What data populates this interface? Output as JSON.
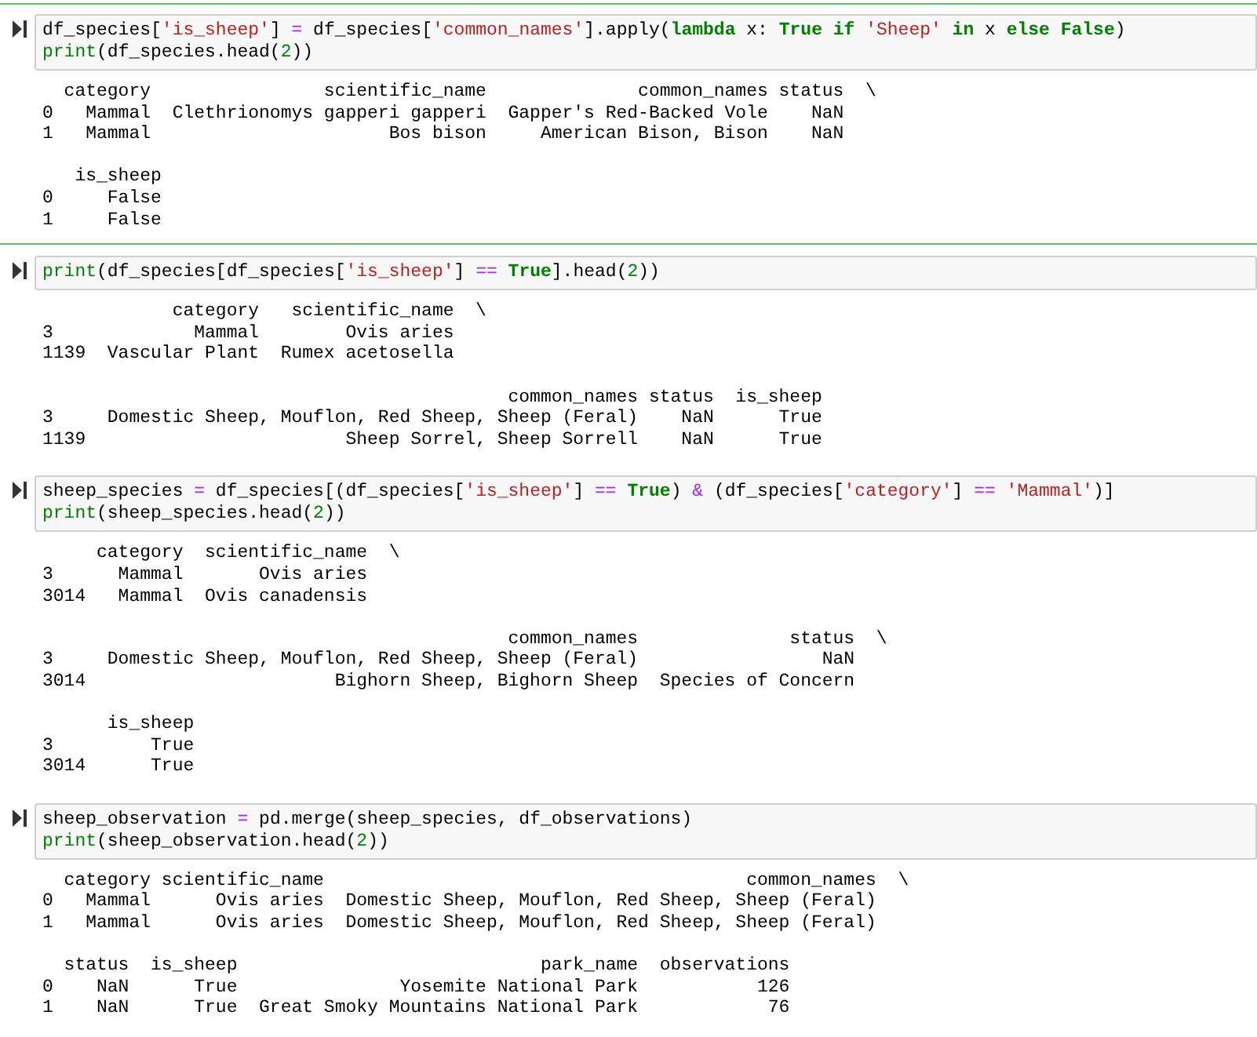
{
  "cells": [
    {
      "selected": true,
      "input": [
        {
          "tokens": [
            {
              "kind": "plain",
              "text": "df_species["
            },
            {
              "kind": "string",
              "text": "'is_sheep'"
            },
            {
              "kind": "plain",
              "text": "] "
            },
            {
              "kind": "operator",
              "text": "="
            },
            {
              "kind": "plain",
              "text": " df_species["
            },
            {
              "kind": "string",
              "text": "'common_names'"
            },
            {
              "kind": "plain",
              "text": "].apply("
            },
            {
              "kind": "keyword",
              "text": "lambda"
            },
            {
              "kind": "plain",
              "text": " x: "
            },
            {
              "kind": "keyword",
              "text": "True"
            },
            {
              "kind": "keyword",
              "text": " if"
            },
            {
              "kind": "string",
              "text": " 'Sheep'"
            },
            {
              "kind": "keyword",
              "text": " in"
            },
            {
              "kind": "plain",
              "text": " x "
            },
            {
              "kind": "keyword",
              "text": "else"
            },
            {
              "kind": "keyword",
              "text": " False"
            },
            {
              "kind": "plain",
              "text": ")"
            }
          ]
        },
        {
          "tokens": [
            {
              "kind": "builtin",
              "text": "print"
            },
            {
              "kind": "plain",
              "text": "(df_species.head("
            },
            {
              "kind": "number",
              "text": "2"
            },
            {
              "kind": "plain",
              "text": "))"
            }
          ]
        }
      ],
      "output": [
        {
          "lines": [
            "  category                scientific_name              common_names status  \\",
            "0   Mammal  Clethrionomys gapperi gapperi  Gapper's Red-Backed Vole    NaN",
            "1   Mammal                      Bos bison     American Bison, Bison    NaN"
          ]
        },
        {
          "lines": [
            "   is_sheep",
            "0     False",
            "1     False"
          ]
        }
      ]
    },
    {
      "selected": false,
      "input": [
        {
          "tokens": [
            {
              "kind": "builtin",
              "text": "print"
            },
            {
              "kind": "plain",
              "text": "(df_species[df_species["
            },
            {
              "kind": "string",
              "text": "'is_sheep'"
            },
            {
              "kind": "plain",
              "text": "] "
            },
            {
              "kind": "operator",
              "text": "=="
            },
            {
              "kind": "keyword",
              "text": " True"
            },
            {
              "kind": "plain",
              "text": "].head("
            },
            {
              "kind": "number",
              "text": "2"
            },
            {
              "kind": "plain",
              "text": "))"
            }
          ]
        }
      ],
      "output": [
        {
          "lines": [
            "            category   scientific_name  \\",
            "3             Mammal        Ovis aries",
            "1139  Vascular Plant  Rumex acetosella"
          ]
        },
        {
          "lines": [
            "                                           common_names status  is_sheep",
            "3     Domestic Sheep, Mouflon, Red Sheep, Sheep (Feral)    NaN      True",
            "1139                        Sheep Sorrel, Sheep Sorrell    NaN      True"
          ]
        }
      ]
    },
    {
      "selected": false,
      "input": [
        {
          "tokens": [
            {
              "kind": "plain",
              "text": "sheep_species "
            },
            {
              "kind": "operator",
              "text": "="
            },
            {
              "kind": "plain",
              "text": " df_species[(df_species["
            },
            {
              "kind": "string",
              "text": "'is_sheep'"
            },
            {
              "kind": "plain",
              "text": "] "
            },
            {
              "kind": "operator",
              "text": "=="
            },
            {
              "kind": "keyword",
              "text": " True"
            },
            {
              "kind": "plain",
              "text": ") "
            },
            {
              "kind": "operator",
              "text": "&"
            },
            {
              "kind": "plain",
              "text": " (df_species["
            },
            {
              "kind": "string",
              "text": "'category'"
            },
            {
              "kind": "plain",
              "text": "] "
            },
            {
              "kind": "operator",
              "text": "=="
            },
            {
              "kind": "string",
              "text": " 'Mammal'"
            },
            {
              "kind": "plain",
              "text": ")]"
            }
          ]
        },
        {
          "tokens": [
            {
              "kind": "builtin",
              "text": "print"
            },
            {
              "kind": "plain",
              "text": "(sheep_species.head("
            },
            {
              "kind": "number",
              "text": "2"
            },
            {
              "kind": "plain",
              "text": "))"
            }
          ]
        }
      ],
      "output": [
        {
          "lines": [
            "     category  scientific_name  \\",
            "3      Mammal       Ovis aries",
            "3014   Mammal  Ovis canadensis"
          ]
        },
        {
          "lines": [
            "                                           common_names              status  \\",
            "3     Domestic Sheep, Mouflon, Red Sheep, Sheep (Feral)                 NaN",
            "3014                       Bighorn Sheep, Bighorn Sheep  Species of Concern"
          ]
        },
        {
          "lines": [
            "      is_sheep",
            "3         True",
            "3014      True"
          ]
        }
      ]
    },
    {
      "selected": false,
      "input": [
        {
          "tokens": [
            {
              "kind": "plain",
              "text": "sheep_observation "
            },
            {
              "kind": "operator",
              "text": "="
            },
            {
              "kind": "plain",
              "text": " pd.merge(sheep_species, df_observations)"
            }
          ]
        },
        {
          "tokens": [
            {
              "kind": "builtin",
              "text": "print"
            },
            {
              "kind": "plain",
              "text": "(sheep_observation.head("
            },
            {
              "kind": "number",
              "text": "2"
            },
            {
              "kind": "plain",
              "text": "))"
            }
          ]
        }
      ],
      "output": [
        {
          "lines": [
            "  category scientific_name                                       common_names  \\",
            "0   Mammal      Ovis aries  Domestic Sheep, Mouflon, Red Sheep, Sheep (Feral)",
            "1   Mammal      Ovis aries  Domestic Sheep, Mouflon, Red Sheep, Sheep (Feral)"
          ]
        },
        {
          "lines": [
            "  status  is_sheep                            park_name  observations",
            "0    NaN      True               Yosemite National Park           126",
            "1    NaN      True  Great Smoky Mountains National Park            76"
          ]
        }
      ]
    }
  ]
}
